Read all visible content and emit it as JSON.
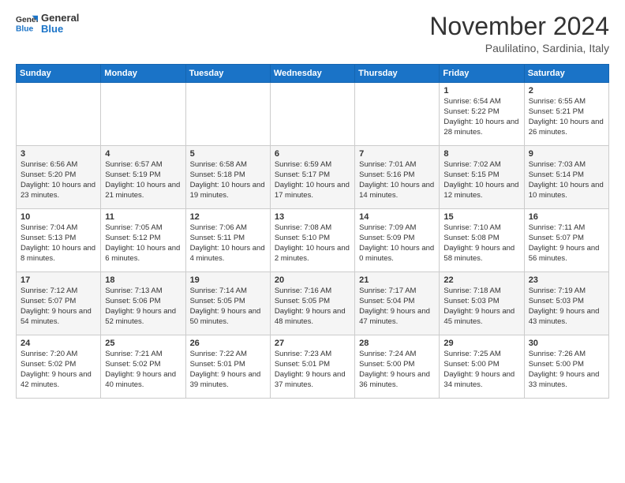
{
  "header": {
    "logo_line1": "General",
    "logo_line2": "Blue",
    "month": "November 2024",
    "location": "Paulilatino, Sardinia, Italy"
  },
  "weekdays": [
    "Sunday",
    "Monday",
    "Tuesday",
    "Wednesday",
    "Thursday",
    "Friday",
    "Saturday"
  ],
  "weeks": [
    [
      {
        "day": "",
        "info": ""
      },
      {
        "day": "",
        "info": ""
      },
      {
        "day": "",
        "info": ""
      },
      {
        "day": "",
        "info": ""
      },
      {
        "day": "",
        "info": ""
      },
      {
        "day": "1",
        "info": "Sunrise: 6:54 AM\nSunset: 5:22 PM\nDaylight: 10 hours and 28 minutes."
      },
      {
        "day": "2",
        "info": "Sunrise: 6:55 AM\nSunset: 5:21 PM\nDaylight: 10 hours and 26 minutes."
      }
    ],
    [
      {
        "day": "3",
        "info": "Sunrise: 6:56 AM\nSunset: 5:20 PM\nDaylight: 10 hours and 23 minutes."
      },
      {
        "day": "4",
        "info": "Sunrise: 6:57 AM\nSunset: 5:19 PM\nDaylight: 10 hours and 21 minutes."
      },
      {
        "day": "5",
        "info": "Sunrise: 6:58 AM\nSunset: 5:18 PM\nDaylight: 10 hours and 19 minutes."
      },
      {
        "day": "6",
        "info": "Sunrise: 6:59 AM\nSunset: 5:17 PM\nDaylight: 10 hours and 17 minutes."
      },
      {
        "day": "7",
        "info": "Sunrise: 7:01 AM\nSunset: 5:16 PM\nDaylight: 10 hours and 14 minutes."
      },
      {
        "day": "8",
        "info": "Sunrise: 7:02 AM\nSunset: 5:15 PM\nDaylight: 10 hours and 12 minutes."
      },
      {
        "day": "9",
        "info": "Sunrise: 7:03 AM\nSunset: 5:14 PM\nDaylight: 10 hours and 10 minutes."
      }
    ],
    [
      {
        "day": "10",
        "info": "Sunrise: 7:04 AM\nSunset: 5:13 PM\nDaylight: 10 hours and 8 minutes."
      },
      {
        "day": "11",
        "info": "Sunrise: 7:05 AM\nSunset: 5:12 PM\nDaylight: 10 hours and 6 minutes."
      },
      {
        "day": "12",
        "info": "Sunrise: 7:06 AM\nSunset: 5:11 PM\nDaylight: 10 hours and 4 minutes."
      },
      {
        "day": "13",
        "info": "Sunrise: 7:08 AM\nSunset: 5:10 PM\nDaylight: 10 hours and 2 minutes."
      },
      {
        "day": "14",
        "info": "Sunrise: 7:09 AM\nSunset: 5:09 PM\nDaylight: 10 hours and 0 minutes."
      },
      {
        "day": "15",
        "info": "Sunrise: 7:10 AM\nSunset: 5:08 PM\nDaylight: 9 hours and 58 minutes."
      },
      {
        "day": "16",
        "info": "Sunrise: 7:11 AM\nSunset: 5:07 PM\nDaylight: 9 hours and 56 minutes."
      }
    ],
    [
      {
        "day": "17",
        "info": "Sunrise: 7:12 AM\nSunset: 5:07 PM\nDaylight: 9 hours and 54 minutes."
      },
      {
        "day": "18",
        "info": "Sunrise: 7:13 AM\nSunset: 5:06 PM\nDaylight: 9 hours and 52 minutes."
      },
      {
        "day": "19",
        "info": "Sunrise: 7:14 AM\nSunset: 5:05 PM\nDaylight: 9 hours and 50 minutes."
      },
      {
        "day": "20",
        "info": "Sunrise: 7:16 AM\nSunset: 5:05 PM\nDaylight: 9 hours and 48 minutes."
      },
      {
        "day": "21",
        "info": "Sunrise: 7:17 AM\nSunset: 5:04 PM\nDaylight: 9 hours and 47 minutes."
      },
      {
        "day": "22",
        "info": "Sunrise: 7:18 AM\nSunset: 5:03 PM\nDaylight: 9 hours and 45 minutes."
      },
      {
        "day": "23",
        "info": "Sunrise: 7:19 AM\nSunset: 5:03 PM\nDaylight: 9 hours and 43 minutes."
      }
    ],
    [
      {
        "day": "24",
        "info": "Sunrise: 7:20 AM\nSunset: 5:02 PM\nDaylight: 9 hours and 42 minutes."
      },
      {
        "day": "25",
        "info": "Sunrise: 7:21 AM\nSunset: 5:02 PM\nDaylight: 9 hours and 40 minutes."
      },
      {
        "day": "26",
        "info": "Sunrise: 7:22 AM\nSunset: 5:01 PM\nDaylight: 9 hours and 39 minutes."
      },
      {
        "day": "27",
        "info": "Sunrise: 7:23 AM\nSunset: 5:01 PM\nDaylight: 9 hours and 37 minutes."
      },
      {
        "day": "28",
        "info": "Sunrise: 7:24 AM\nSunset: 5:00 PM\nDaylight: 9 hours and 36 minutes."
      },
      {
        "day": "29",
        "info": "Sunrise: 7:25 AM\nSunset: 5:00 PM\nDaylight: 9 hours and 34 minutes."
      },
      {
        "day": "30",
        "info": "Sunrise: 7:26 AM\nSunset: 5:00 PM\nDaylight: 9 hours and 33 minutes."
      }
    ]
  ]
}
